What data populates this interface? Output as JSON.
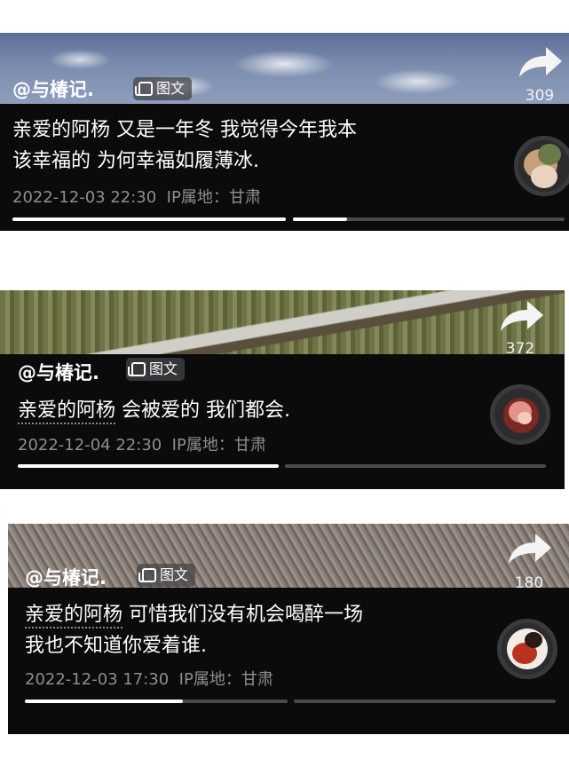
{
  "posts": [
    {
      "username": "@与椿记.",
      "badge": "图文",
      "share_count": "309",
      "line1_prefix": "",
      "line1_rest": "亲爱的阿杨 又是一年冬 我觉得今年我本",
      "line2": "该幸福的 为何幸福如履薄冰.",
      "timestamp": "2022-12-03 22:30",
      "location": "IP属地：甘肃",
      "progress": [
        1.0,
        0.2
      ],
      "share_icon": "share-arrow-icon",
      "avatar_icon": "avatar"
    },
    {
      "username": "@与椿记.",
      "badge": "图文",
      "share_count": "372",
      "line1_prefix": "亲爱的阿杨",
      "line1_rest": " 会被爱的 我们都会.",
      "line2": "",
      "timestamp": "2022-12-04 22:30",
      "location": "IP属地：甘肃",
      "progress": [
        1.0,
        0.0
      ],
      "share_icon": "share-arrow-icon",
      "avatar_icon": "avatar"
    },
    {
      "username": "@与椿记.",
      "badge": "图文",
      "share_count": "180",
      "line1_prefix": "亲爱的阿杨",
      "line1_rest": " 可惜我们没有机会喝醉一场",
      "line2": "我也不知道你爱着谁.",
      "timestamp": "2022-12-03 17:30",
      "location": "IP属地：甘肃",
      "progress": [
        0.6,
        0.0
      ],
      "share_icon": "share-arrow-icon",
      "avatar_icon": "avatar"
    }
  ],
  "colors": {
    "card_background": "#0b0b0c",
    "meta_text": "#8e8e92",
    "progress_track": "#4b4b4e",
    "progress_fill": "#ffffff"
  }
}
